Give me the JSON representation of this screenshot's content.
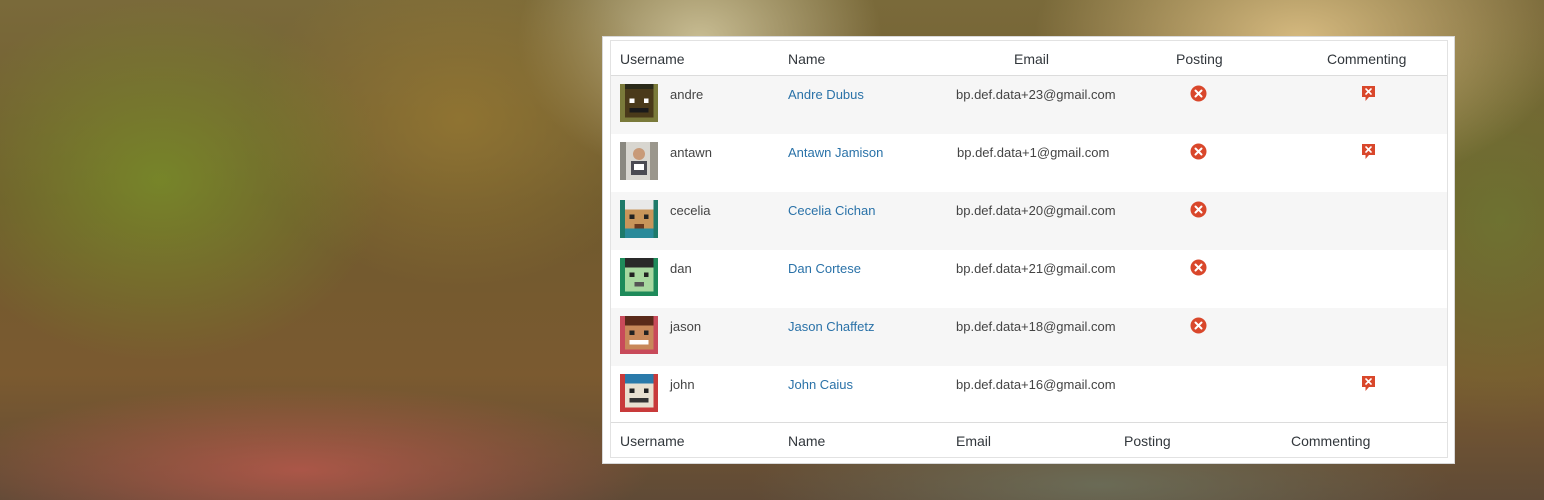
{
  "table": {
    "header": {
      "username": "Username",
      "name": "Name",
      "email": "Email",
      "posting": "Posting",
      "commenting": "Commenting"
    },
    "footer": {
      "username": "Username",
      "name": "Name",
      "email": "Email",
      "posting": "Posting",
      "commenting": "Commenting"
    },
    "rows": [
      {
        "username": "andre",
        "name": "Andre Dubus",
        "email": "bp.def.data+23@gmail.com",
        "posting_blocked": true,
        "commenting_blocked": true
      },
      {
        "username": "antawn",
        "name": "Antawn Jamison",
        "email": "bp.def.data+1@gmail.com",
        "posting_blocked": true,
        "commenting_blocked": true
      },
      {
        "username": "cecelia",
        "name": "Cecelia Cichan",
        "email": "bp.def.data+20@gmail.com",
        "posting_blocked": true,
        "commenting_blocked": false
      },
      {
        "username": "dan",
        "name": "Dan Cortese",
        "email": "bp.def.data+21@gmail.com",
        "posting_blocked": true,
        "commenting_blocked": false
      },
      {
        "username": "jason",
        "name": "Jason Chaffetz",
        "email": "bp.def.data+18@gmail.com",
        "posting_blocked": true,
        "commenting_blocked": false
      },
      {
        "username": "john",
        "name": "John Caius",
        "email": "bp.def.data+16@gmail.com",
        "posting_blocked": false,
        "commenting_blocked": true
      }
    ]
  },
  "icons": {
    "posting": "blocked-circle-x-icon",
    "commenting": "comment-blocked-icon"
  },
  "colors": {
    "name_link": "#2a72a8",
    "blocked_icon": "#d9472b",
    "row_alt": "#f6f6f6"
  }
}
